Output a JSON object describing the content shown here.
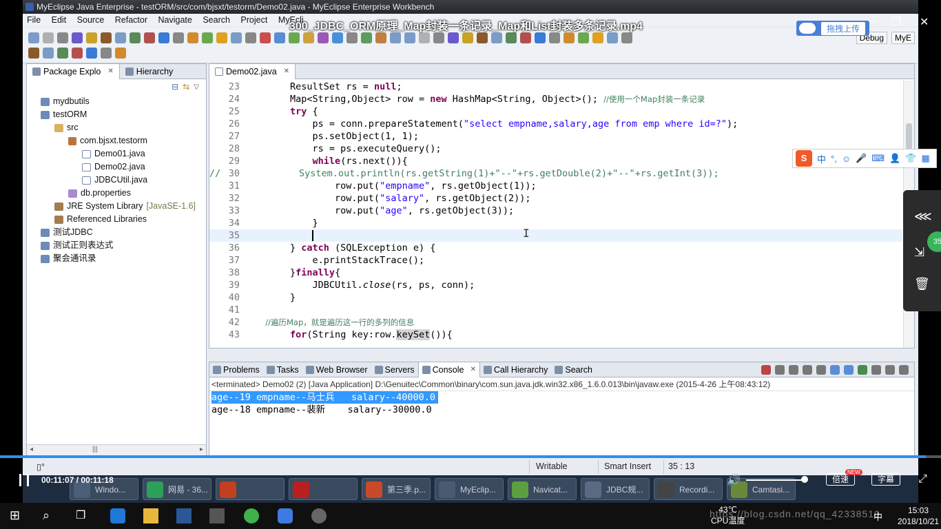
{
  "window": {
    "title": "MyEclipse Java Enterprise - testORM/src/com/bjsxt/testorm/Demo02.java - MyEclipse Enterprise Workbench"
  },
  "menu": [
    "File",
    "Edit",
    "Source",
    "Refactor",
    "Navigate",
    "Search",
    "Project",
    "MyEcli"
  ],
  "perspectives": [
    "Debug",
    "MyE"
  ],
  "video": {
    "title": "300_JDBC_ORM原理_Map封装一条记录_Map和List封装多条记录.mp4",
    "upload_label": "拖拽上传",
    "current_time": "00:11:07",
    "total_time": "00:11:18",
    "progress": 0.984,
    "speed_label": "倍速",
    "subtitle_label": "字幕",
    "new_tag": "NEW",
    "badge": "35"
  },
  "ime": {
    "lang": "中",
    "punct": "°,"
  },
  "explorer": {
    "tab_label": "Package Explo",
    "hierarchy_label": "Hierarchy",
    "items": [
      {
        "label": "mydbutils",
        "icon": "project-icon"
      },
      {
        "label": "testORM",
        "icon": "project-icon"
      },
      {
        "label": "src",
        "icon": "source-folder-icon"
      },
      {
        "label": "com.bjsxt.testorm",
        "icon": "package-icon"
      },
      {
        "label": "Demo01.java",
        "icon": "java-file-icon"
      },
      {
        "label": "Demo02.java",
        "icon": "java-file-icon"
      },
      {
        "label": "JDBCUtil.java",
        "icon": "java-file-icon"
      },
      {
        "label": "db.properties",
        "icon": "properties-file-icon"
      },
      {
        "label": "JRE System Library",
        "decoration": "[JavaSE-1.6]",
        "icon": "library-icon"
      },
      {
        "label": "Referenced Libraries",
        "icon": "library-icon"
      },
      {
        "label": "测试JDBC",
        "icon": "project-icon"
      },
      {
        "label": "测试正则表达式",
        "icon": "project-icon"
      },
      {
        "label": "聚会通讯录",
        "icon": "project-icon"
      }
    ]
  },
  "editor": {
    "tab_label": "Demo02.java",
    "lines": [
      {
        "n": "23",
        "code": "        ResultSet rs = null;"
      },
      {
        "n": "24",
        "code": "        Map<String,Object> row = new HashMap<String, Object>(); //使用一个Map封装一条记录"
      },
      {
        "n": "25",
        "code": "        try {"
      },
      {
        "n": "26",
        "code": "            ps = conn.prepareStatement(\"select empname,salary,age from emp where id=?\");"
      },
      {
        "n": "27",
        "code": "            ps.setObject(1, 1);"
      },
      {
        "n": "28",
        "code": "            rs = ps.executeQuery();"
      },
      {
        "n": "29",
        "code": "            while(rs.next()){"
      },
      {
        "n": "30",
        "code": "//              System.out.println(rs.getString(1)+\"--\"+rs.getDouble(2)+\"--\"+rs.getInt(3));"
      },
      {
        "n": "31",
        "code": "                row.put(\"empname\", rs.getObject(1));"
      },
      {
        "n": "32",
        "code": "                row.put(\"salary\", rs.getObject(2));"
      },
      {
        "n": "33",
        "code": "                row.put(\"age\", rs.getObject(3));"
      },
      {
        "n": "34",
        "code": "            }"
      },
      {
        "n": "35",
        "code": ""
      },
      {
        "n": "36",
        "code": "        } catch (SQLException e) {"
      },
      {
        "n": "37",
        "code": "            e.printStackTrace();"
      },
      {
        "n": "38",
        "code": "        }finally{"
      },
      {
        "n": "39",
        "code": "            JDBCUtil.close(rs, ps, conn);"
      },
      {
        "n": "40",
        "code": "        }"
      },
      {
        "n": "41",
        "code": ""
      },
      {
        "n": "42",
        "code": "        //遍历Map，就是遍历这一行的多列的信息"
      },
      {
        "n": "43",
        "code": "        for(String key:row.keySet()){"
      }
    ]
  },
  "console": {
    "tabs": [
      "Problems",
      "Tasks",
      "Web Browser",
      "Servers",
      "Console",
      "Call Hierarchy",
      "Search"
    ],
    "status": "<terminated> Demo02 (2) [Java Application] D:\\Genuitec\\Common\\binary\\com.sun.java.jdk.win32.x86_1.6.0.013\\bin\\javaw.exe (2015-4-26 上午08:43:12)",
    "output": [
      "age--19 empname--马士兵   salary--40000.0",
      "age--18 empname--裴新    salary--30000.0"
    ]
  },
  "statusbar": {
    "writable": "Writable",
    "insert_mode": "Smart Insert",
    "position": "35 : 13"
  },
  "old_taskbar": [
    "Windo...",
    "网易 - 36...",
    "",
    "",
    "第三季.p...",
    "MyEclip...",
    "Navicat...",
    "JDBC规...",
    "Recordi...",
    "Camtasi..."
  ],
  "tray": {
    "temp": "43℃",
    "temp_label": "CPU温度",
    "ime": "中",
    "time": "15:03",
    "date": "2018/10/21"
  },
  "watermark": "https://blog.csdn.net/qq_42338510",
  "colors": {
    "progress": "#2a8ff7",
    "keyword": "#7f0055",
    "string": "#2a00ff",
    "comment": "#3f7f5f",
    "selection": "#3399ff"
  }
}
